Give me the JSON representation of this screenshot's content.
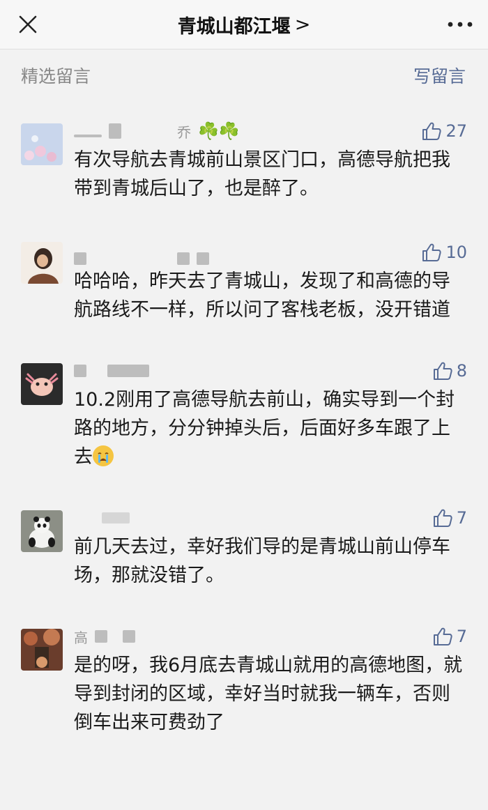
{
  "header": {
    "title": "青城山都江堰",
    "chevron": ">",
    "close_icon": "close-icon",
    "more_icon": "more-icon"
  },
  "section": {
    "label": "精选留言",
    "write_link": "写留言"
  },
  "comments": [
    {
      "text": "有次导航去青城前山景区门口，高德导航把我带到青城后山了，也是醉了。",
      "likes": "27",
      "nickname_suffix": "乔",
      "nickname_emoji": "☘️☘️"
    },
    {
      "text": "哈哈哈，昨天去了青城山，发现了和高德的导航路线不一样，所以问了客栈老板，没开错道",
      "likes": "10"
    },
    {
      "text": "10.2刚用了高德导航去前山，确实导到一个封路的地方，分分钟掉头后，后面好多车跟了上去",
      "likes": "8",
      "emoji": "crying-face"
    },
    {
      "text": "前几天去过，幸好我们导的是青城山前山停车场，那就没错了。",
      "likes": "7"
    },
    {
      "text": "是的呀，我6月底去青城山就用的高德地图，就导到封闭的区域，幸好当时就我一辆车，否则倒车出来可费劲了",
      "likes": "7",
      "nickname_prefix": "高"
    }
  ]
}
